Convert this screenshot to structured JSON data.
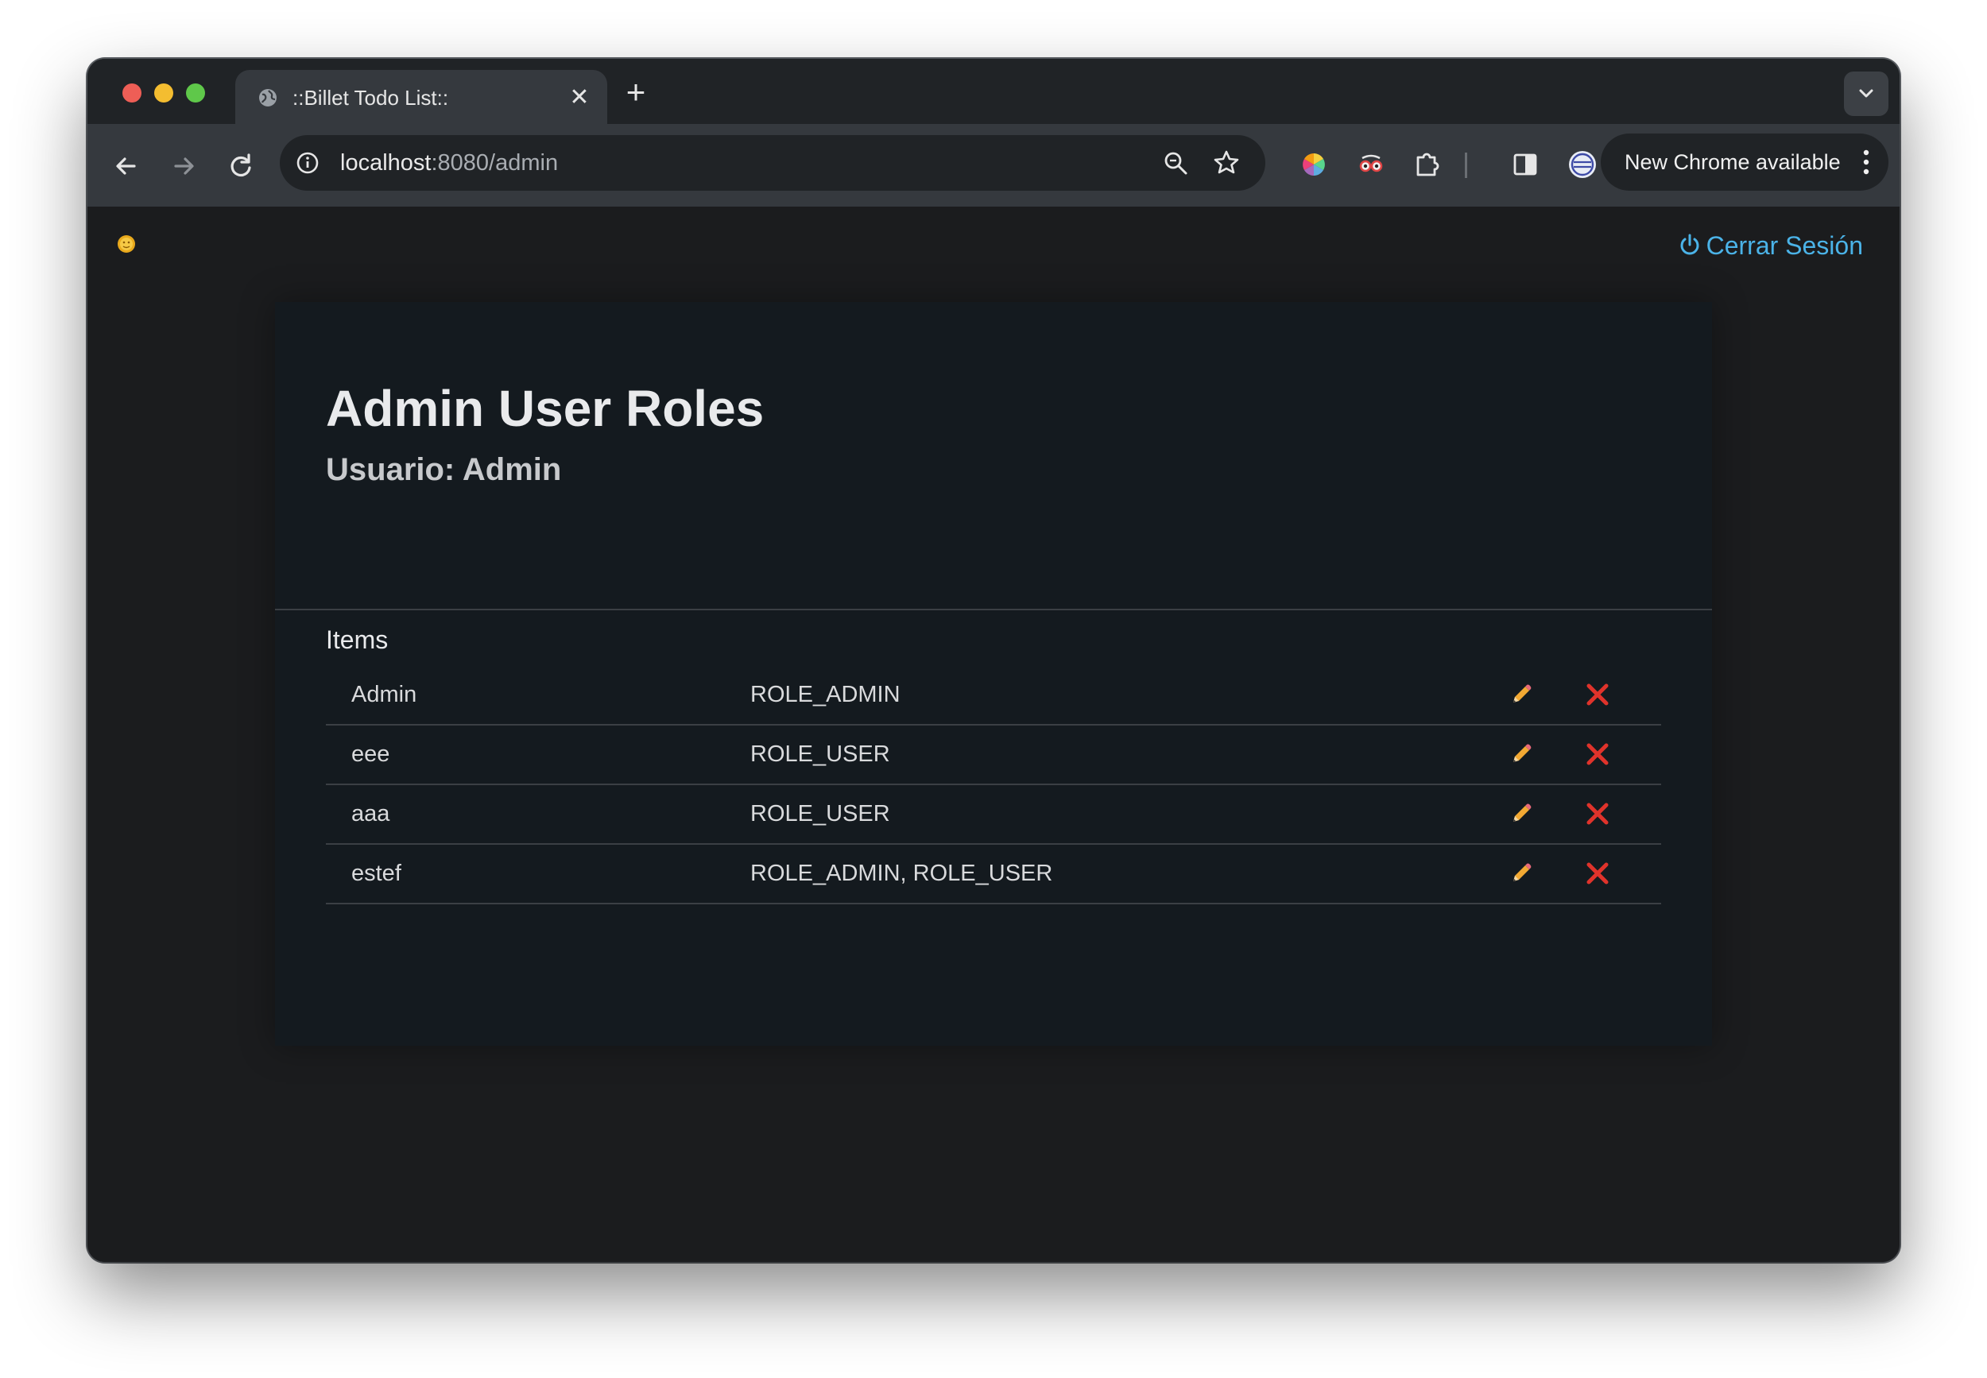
{
  "browser": {
    "tab_title": "::Billet Todo List::",
    "url_host": "localhost",
    "url_rest": ":8080/admin",
    "update_label": "New Chrome available"
  },
  "header": {
    "logout_label": "Cerrar Sesión"
  },
  "main": {
    "title": "Admin User Roles",
    "subtitle": "Usuario: Admin",
    "section_label": "Items",
    "rows": [
      {
        "user": "Admin",
        "roles": "ROLE_ADMIN"
      },
      {
        "user": "eee",
        "roles": "ROLE_USER"
      },
      {
        "user": "aaa",
        "roles": "ROLE_USER"
      },
      {
        "user": "estef",
        "roles": "ROLE_ADMIN, ROLE_USER"
      }
    ]
  },
  "colors": {
    "page_background": "#1b1c1e",
    "card_background": "#141a1f",
    "link": "#4bb3e8",
    "delete": "#e0332b",
    "edit": "#f2a933"
  },
  "icons": {
    "theme_toggle": "sun-icon",
    "logout": "power-icon",
    "edit": "pencil-icon",
    "delete": "close-x-icon"
  }
}
